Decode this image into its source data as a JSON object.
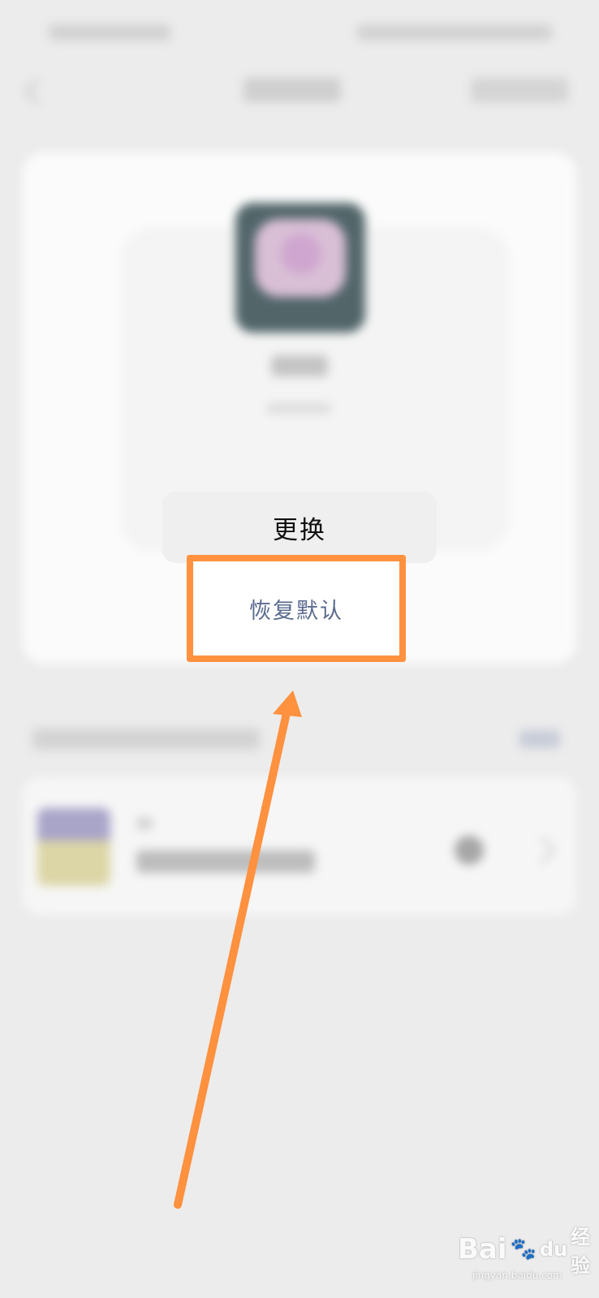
{
  "action_sheet": {
    "change_label": "更换",
    "restore_default_label": "恢复默认"
  },
  "annotation": {
    "highlight_color": "#ff913f",
    "arrow_color": "#ff913f"
  },
  "watermark": {
    "brand": "Bai",
    "brand_suffix": "du",
    "cn_text": "经验",
    "url": "jingyan.baidu.com"
  },
  "colors": {
    "background": "#ececec",
    "restore_text": "#5a6b8e"
  }
}
